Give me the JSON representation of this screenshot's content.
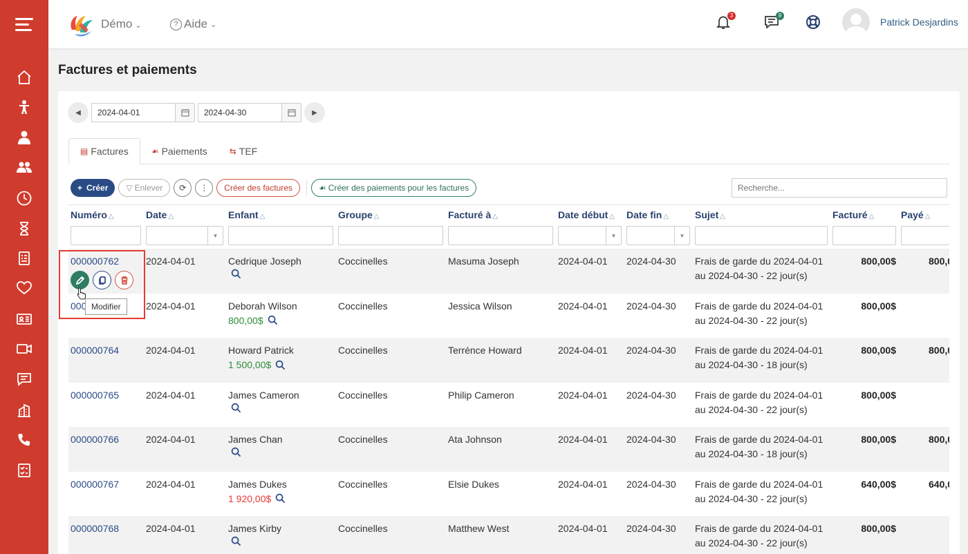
{
  "header": {
    "brand": "Démo",
    "help": "Aide",
    "notifications_count": "3",
    "messages_count": "9",
    "user_name": "Patrick Desjardins"
  },
  "sidebar_icons": [
    "home-icon",
    "child-icon",
    "staff-icon",
    "parents-icon",
    "clock-icon",
    "hourglass-icon",
    "invoice-icon",
    "heart-icon",
    "id-card-icon",
    "video-icon",
    "chat-icon",
    "building-icon",
    "phone-icon",
    "report-icon"
  ],
  "page": {
    "title": "Factures et paiements"
  },
  "date_range": {
    "start": "2024-04-01",
    "end": "2024-04-30"
  },
  "tabs": [
    {
      "label": "Factures",
      "active": true
    },
    {
      "label": "Paiements",
      "active": false
    },
    {
      "label": "TEF",
      "active": false
    }
  ],
  "toolbar": {
    "create": "Créer",
    "remove": "Enlever",
    "create_invoices": "Créer des factures",
    "create_payments": "Créer des paiements pour les factures",
    "search_placeholder": "Recherche..."
  },
  "columns": [
    "Numéro",
    "Date",
    "Enfant",
    "Groupe",
    "Facturé à",
    "Date début",
    "Date fin",
    "Sujet",
    "Facturé",
    "Payé"
  ],
  "rows": [
    {
      "numero": "000000762",
      "date": "2024-04-01",
      "enfant": "Cedrique Joseph",
      "solde": "",
      "solde_color": "",
      "groupe": "Coccinelles",
      "facture_a": "Masuma Joseph",
      "debut": "2024-04-01",
      "fin": "2024-04-30",
      "sujet1": "Frais de garde du 2024-04-01",
      "sujet2": "au 2024-04-30 - 22 jour(s)",
      "facture": "800,00$",
      "paye": "800,0"
    },
    {
      "numero": "000000763",
      "date": "2024-04-01",
      "enfant": "Deborah Wilson",
      "solde": "800,00$",
      "solde_color": "green",
      "groupe": "Coccinelles",
      "facture_a": "Jessica Wilson",
      "debut": "2024-04-01",
      "fin": "2024-04-30",
      "sujet1": "Frais de garde du 2024-04-01",
      "sujet2": "au 2024-04-30 - 22 jour(s)",
      "facture": "800,00$",
      "paye": ""
    },
    {
      "numero": "000000764",
      "date": "2024-04-01",
      "enfant": "Howard Patrick",
      "solde": "1 500,00$",
      "solde_color": "green",
      "groupe": "Coccinelles",
      "facture_a": "Terrénce Howard",
      "debut": "2024-04-01",
      "fin": "2024-04-30",
      "sujet1": "Frais de garde du 2024-04-01",
      "sujet2": "au 2024-04-30 - 18 jour(s)",
      "facture": "800,00$",
      "paye": "800,0"
    },
    {
      "numero": "000000765",
      "date": "2024-04-01",
      "enfant": "James Cameron",
      "solde": "",
      "solde_color": "",
      "groupe": "Coccinelles",
      "facture_a": "Philip Cameron",
      "debut": "2024-04-01",
      "fin": "2024-04-30",
      "sujet1": "Frais de garde du 2024-04-01",
      "sujet2": "au 2024-04-30 - 22 jour(s)",
      "facture": "800,00$",
      "paye": ""
    },
    {
      "numero": "000000766",
      "date": "2024-04-01",
      "enfant": "James Chan",
      "solde": "",
      "solde_color": "",
      "groupe": "Coccinelles",
      "facture_a": "Ata Johnson",
      "debut": "2024-04-01",
      "fin": "2024-04-30",
      "sujet1": "Frais de garde du 2024-04-01",
      "sujet2": "au 2024-04-30 - 18 jour(s)",
      "facture": "800,00$",
      "paye": "800,0"
    },
    {
      "numero": "000000767",
      "date": "2024-04-01",
      "enfant": "James Dukes",
      "solde": "1 920,00$",
      "solde_color": "red",
      "groupe": "Coccinelles",
      "facture_a": "Elsie Dukes",
      "debut": "2024-04-01",
      "fin": "2024-04-30",
      "sujet1": "Frais de garde du 2024-04-01",
      "sujet2": "au 2024-04-30 - 22 jour(s)",
      "facture": "640,00$",
      "paye": "640,0"
    },
    {
      "numero": "000000768",
      "date": "2024-04-01",
      "enfant": "James Kirby",
      "solde": "",
      "solde_color": "",
      "groupe": "Coccinelles",
      "facture_a": "Matthew West",
      "debut": "2024-04-01",
      "fin": "2024-04-30",
      "sujet1": "Frais de garde du 2024-04-01",
      "sujet2": "au 2024-04-30 - 22 jour(s)",
      "facture": "800,00$",
      "paye": ""
    }
  ],
  "row_actions": {
    "tooltip": "Modifier"
  },
  "colors": {
    "sidebar": "#cf3c2e",
    "primary": "#2a4b84",
    "link": "#2a4a86",
    "edit": "#2e7d62",
    "danger": "#d0533f",
    "highlight": "#e53935"
  }
}
